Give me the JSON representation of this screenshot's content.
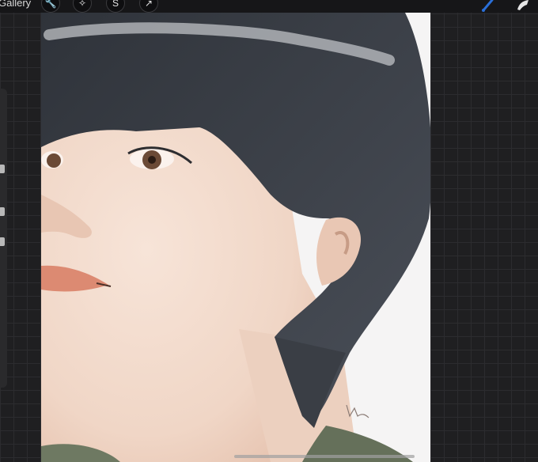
{
  "app": {
    "gallery_label": "Gallery",
    "toolbar_left": [
      {
        "name": "actions-wrench-icon",
        "glyph": "🔧"
      },
      {
        "name": "adjustments-wand-icon",
        "glyph": "✧"
      },
      {
        "name": "selection-icon",
        "glyph": "S"
      },
      {
        "name": "transform-arrow-icon",
        "glyph": "↗"
      }
    ],
    "toolbar_right": [
      {
        "name": "brush-icon"
      },
      {
        "name": "smudge-icon"
      }
    ]
  },
  "artwork": {
    "subject": "",
    "signature": "lw"
  },
  "colors": {
    "background": "#1f1f21",
    "canvas_bg": "#f5f4f4",
    "hair": "#3b3f46",
    "skin": "#f2d9cc",
    "lips": "#dc8a72",
    "eye": "#6b4a36",
    "shirt": "#65705a",
    "brush_accent": "#2a6fd8"
  }
}
